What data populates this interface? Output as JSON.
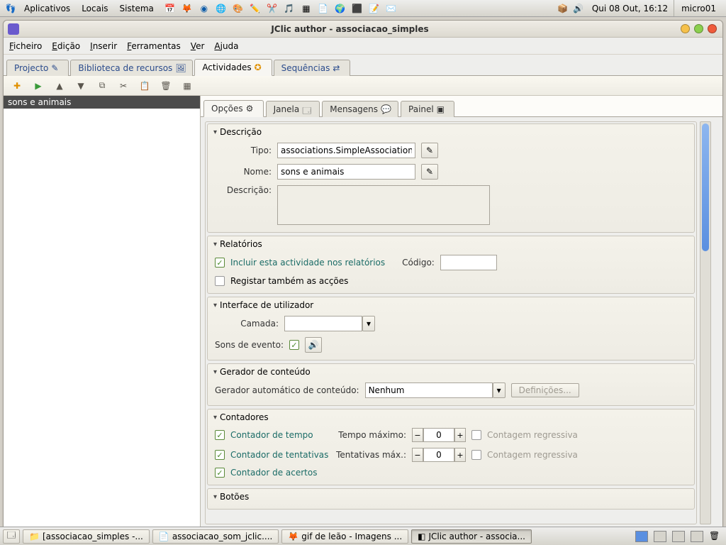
{
  "gnome": {
    "menus": [
      "Aplicativos",
      "Locais",
      "Sistema"
    ],
    "clock": "Qui 08 Out, 16:12",
    "user": "micro01"
  },
  "window": {
    "title": "JClic author - associacao_simples"
  },
  "menubar": {
    "ficheiro": "Ficheiro",
    "edicao": "Edição",
    "inserir": "Inserir",
    "ferramentas": "Ferramentas",
    "ver": "Ver",
    "ajuda": "Ajuda"
  },
  "maintabs": {
    "projecto": "Projecto",
    "biblioteca": "Biblioteca de recursos",
    "actividades": "Actividades",
    "sequencias": "Sequências"
  },
  "sidebar": {
    "items": [
      "sons e animais"
    ]
  },
  "subtabs": {
    "opcoes": "Opções",
    "janela": "Janela",
    "mensagens": "Mensagens",
    "painel": "Painel"
  },
  "sections": {
    "descricao": {
      "title": "Descrição",
      "tipo_label": "Tipo:",
      "tipo_value": "associations.SimpleAssociation",
      "nome_label": "Nome:",
      "nome_value": "sons e animais",
      "descricao_label": "Descrição:",
      "descricao_value": ""
    },
    "relatorios": {
      "title": "Relatórios",
      "incluir": "Incluir esta actividade nos relatórios",
      "codigo_label": "Código:",
      "codigo_value": "",
      "registar": "Registar também as acções"
    },
    "interface": {
      "title": "Interface de utilizador",
      "camada_label": "Camada:",
      "camada_value": "",
      "sons_label": "Sons de evento:"
    },
    "gerador": {
      "title": "Gerador de conteúdo",
      "label": "Gerador automático de conteúdo:",
      "value": "Nenhum",
      "definicoes": "Definições..."
    },
    "contadores": {
      "title": "Contadores",
      "tempo": "Contador de tempo",
      "tempo_max_label": "Tempo máximo:",
      "tempo_max": "0",
      "regressiva1": "Contagem regressiva",
      "tentativas": "Contador de tentativas",
      "tentativas_max_label": "Tentativas máx.:",
      "tentativas_max": "0",
      "regressiva2": "Contagem regressiva",
      "acertos": "Contador de acertos"
    },
    "botoes": {
      "title": "Botões"
    }
  },
  "taskbar": {
    "items": [
      "[associacao_simples -...",
      "associacao_som_jclic....",
      "gif de leão - Imagens ...",
      "JClic author - associa..."
    ]
  }
}
